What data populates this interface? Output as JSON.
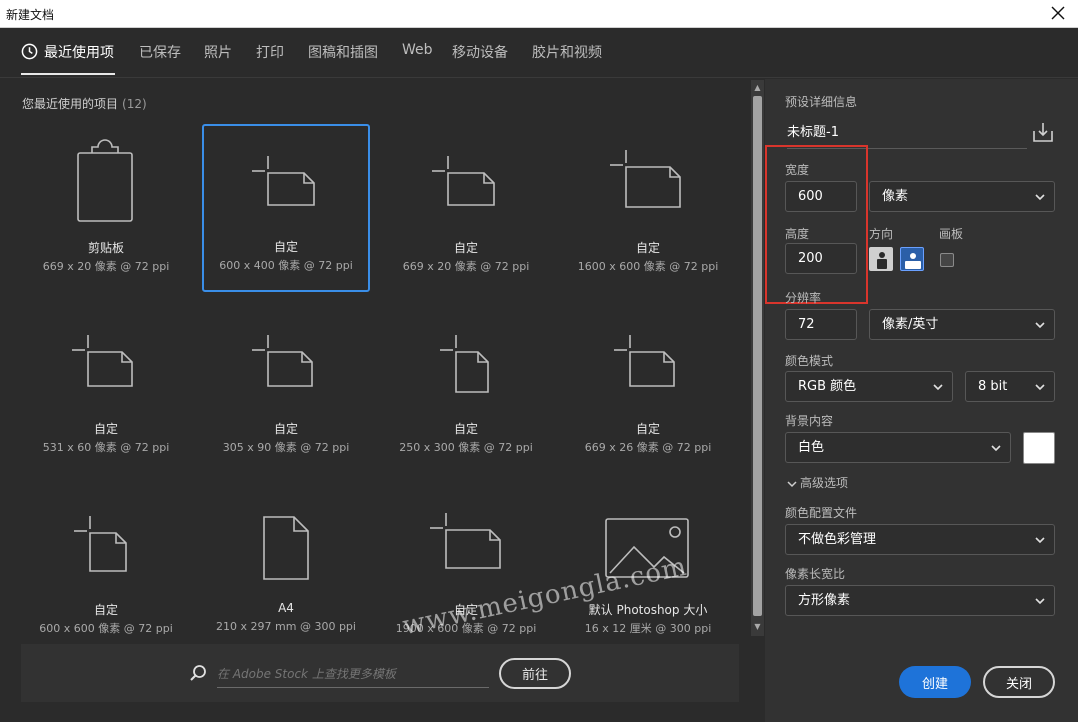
{
  "window": {
    "title": "新建文档"
  },
  "tabs": [
    {
      "label": "最近使用项",
      "active": true
    },
    {
      "label": "已保存"
    },
    {
      "label": "照片"
    },
    {
      "label": "打印"
    },
    {
      "label": "图稿和插图"
    },
    {
      "label": "Web"
    },
    {
      "label": "移动设备"
    },
    {
      "label": "胶片和视频"
    }
  ],
  "recent": {
    "label": "您最近使用的项目",
    "count": "(12)",
    "items": [
      {
        "name": "剪贴板",
        "size": "669 x 20 像素 @ 72 ppi",
        "icon": "clipboard-icon"
      },
      {
        "name": "自定",
        "size": "600 x 400 像素 @ 72 ppi",
        "icon": "custom-doc-icon",
        "selected": true
      },
      {
        "name": "自定",
        "size": "669 x 20 像素 @ 72 ppi",
        "icon": "custom-doc-icon"
      },
      {
        "name": "自定",
        "size": "1600 x 600 像素 @ 72 ppi",
        "icon": "custom-doc-icon"
      },
      {
        "name": "自定",
        "size": "531 x 60 像素 @ 72 ppi",
        "icon": "custom-doc-icon"
      },
      {
        "name": "自定",
        "size": "305 x 90 像素 @ 72 ppi",
        "icon": "custom-doc-icon"
      },
      {
        "name": "自定",
        "size": "250 x 300 像素 @ 72 ppi",
        "icon": "custom-portrait-icon"
      },
      {
        "name": "自定",
        "size": "669 x 26 像素 @ 72 ppi",
        "icon": "custom-doc-icon"
      },
      {
        "name": "自定",
        "size": "600 x 600 像素 @ 72 ppi",
        "icon": "custom-square-icon"
      },
      {
        "name": "A4",
        "size": "210 x 297 mm @ 300 ppi",
        "icon": "page-icon"
      },
      {
        "name": "自定",
        "size": "1900 x 600 像素 @ 72 ppi",
        "icon": "custom-doc-icon"
      },
      {
        "name": "默认 Photoshop 大小",
        "size": "16 x 12 厘米 @ 300 ppi",
        "icon": "image-icon"
      }
    ]
  },
  "stock": {
    "placeholder": "在 Adobe Stock 上查找更多模板",
    "go_label": "前往"
  },
  "details": {
    "heading": "预设详细信息",
    "doc_name": "未标题-1",
    "width_label": "宽度",
    "width_value": "600",
    "width_unit": "像素",
    "height_label": "高度",
    "height_value": "200",
    "orientation_label": "方向",
    "artboard_label": "画板",
    "resolution_label": "分辨率",
    "resolution_value": "72",
    "resolution_unit": "像素/英寸",
    "color_mode_label": "颜色模式",
    "color_mode": "RGB 颜色",
    "bit_depth": "8 bit",
    "background_label": "背景内容",
    "background": "白色",
    "advanced_label": "高级选项",
    "color_profile_label": "颜色配置文件",
    "color_profile": "不做色彩管理",
    "pixel_aspect_label": "像素长宽比",
    "pixel_aspect": "方形像素"
  },
  "actions": {
    "create_label": "创建",
    "close_label": "关闭"
  },
  "watermark": "www.meigongla.com",
  "colors": {
    "accent": "#1e73d9",
    "selection": "#3a8ee8",
    "highlight": "#d9352c"
  }
}
